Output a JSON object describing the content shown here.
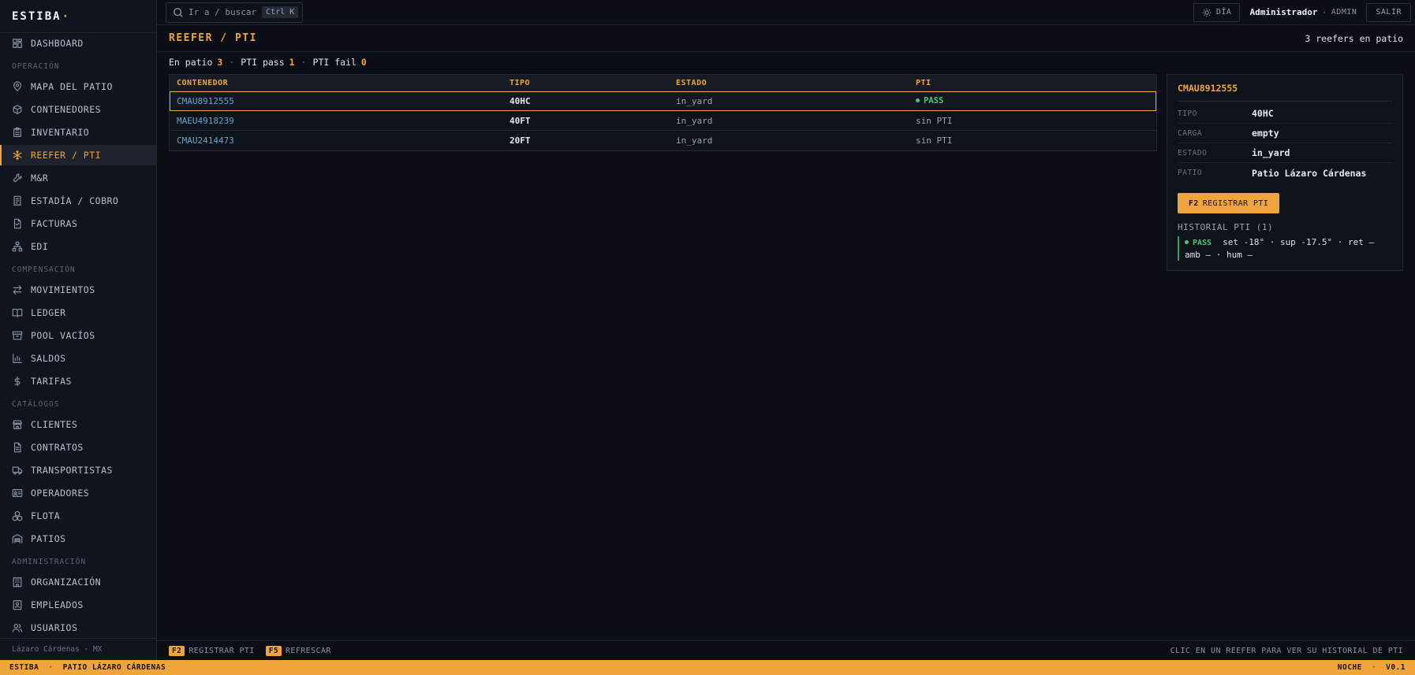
{
  "brand": {
    "name": "ESTIBA",
    "mark": "·"
  },
  "sidebar": {
    "items": [
      {
        "id": "dashboard",
        "label": "DASHBOARD",
        "icon": "dashboard-icon"
      },
      {
        "section": "OPERACIÓN"
      },
      {
        "id": "mapa",
        "label": "MAPA DEL PATIO",
        "icon": "map-pin-icon"
      },
      {
        "id": "contenedores",
        "label": "CONTENEDORES",
        "icon": "box-icon"
      },
      {
        "id": "inventario",
        "label": "INVENTARIO",
        "icon": "clipboard-icon"
      },
      {
        "id": "reefer",
        "label": "REEFER / PTI",
        "icon": "snowflake-icon",
        "active": true
      },
      {
        "id": "myr",
        "label": "M&R",
        "icon": "wrench-icon"
      },
      {
        "id": "estadia",
        "label": "ESTADÍA / COBRO",
        "icon": "receipt-icon"
      },
      {
        "id": "facturas",
        "label": "FACTURAS",
        "icon": "file-icon"
      },
      {
        "id": "edi",
        "label": "EDI",
        "icon": "network-icon"
      },
      {
        "section": "COMPENSACIÓN"
      },
      {
        "id": "movimientos",
        "label": "MOVIMIENTOS",
        "icon": "arrows-icon"
      },
      {
        "id": "ledger",
        "label": "LEDGER",
        "icon": "book-icon"
      },
      {
        "id": "pool",
        "label": "POOL VACÍOS",
        "icon": "archive-icon"
      },
      {
        "id": "saldos",
        "label": "SALDOS",
        "icon": "bar-chart-icon"
      },
      {
        "id": "tarifas",
        "label": "TARIFAS",
        "icon": "dollar-icon"
      },
      {
        "section": "CATÁLOGOS"
      },
      {
        "id": "clientes",
        "label": "CLIENTES",
        "icon": "store-icon"
      },
      {
        "id": "contratos",
        "label": "CONTRATOS",
        "icon": "document-icon"
      },
      {
        "id": "transportistas",
        "label": "TRANSPORTISTAS",
        "icon": "truck-icon"
      },
      {
        "id": "operadores",
        "label": "OPERADORES",
        "icon": "id-card-icon"
      },
      {
        "id": "flota",
        "label": "FLOTA",
        "icon": "boxes-icon"
      },
      {
        "id": "patios",
        "label": "PATIOS",
        "icon": "warehouse-icon"
      },
      {
        "section": "ADMINISTRACIÓN"
      },
      {
        "id": "organizacion",
        "label": "ORGANIZACIÓN",
        "icon": "building-icon"
      },
      {
        "id": "empleados",
        "label": "EMPLEADOS",
        "icon": "badge-icon"
      },
      {
        "id": "usuarios",
        "label": "USUARIOS",
        "icon": "users-icon"
      }
    ],
    "footer": "Lázaro Cárdenas · MX"
  },
  "topbar": {
    "search_placeholder": "Ir a / buscar",
    "search_shortcut": "Ctrl K",
    "theme_label": "DÍA",
    "user_name": "Administrador",
    "separator": "·",
    "user_role": "ADMIN",
    "logout_label": "SALIR"
  },
  "page": {
    "title": "REEFER / PTI",
    "count_label": "3 reefers en patio",
    "summary": {
      "in_yard_label": "En patio",
      "in_yard": "3",
      "pass_label": "PTI pass",
      "pass": "1",
      "fail_label": "PTI fail",
      "fail": "0",
      "sep": "·"
    }
  },
  "table": {
    "headers": {
      "container": "CONTENEDOR",
      "type": "TIPO",
      "state": "ESTADO",
      "pti": "PTI"
    },
    "rows": [
      {
        "container": "CMAU8912555",
        "type": "40HC",
        "state": "in_yard",
        "pti": "PASS",
        "pti_status": "pass",
        "selected": true
      },
      {
        "container": "MAEU4918239",
        "type": "40FT",
        "state": "in_yard",
        "pti": "sin PTI",
        "pti_status": "none"
      },
      {
        "container": "CMAU2414473",
        "type": "20FT",
        "state": "in_yard",
        "pti": "sin PTI",
        "pti_status": "none"
      }
    ]
  },
  "detail": {
    "title": "CMAU8912555",
    "fields": [
      {
        "key": "TIPO",
        "value": "40HC"
      },
      {
        "key": "CARGA",
        "value": "empty"
      },
      {
        "key": "ESTADO",
        "value": "in_yard"
      },
      {
        "key": "PATIO",
        "value": "Patio Lázaro Cárdenas"
      }
    ],
    "action_key": "F2",
    "action_label": "REGISTRAR PTI",
    "history_title": "HISTORIAL PTI (1)",
    "history": [
      {
        "status": "PASS",
        "line1": "set -18° · sup -17.5° · ret —",
        "line2": "amb — · hum —"
      }
    ]
  },
  "hints": {
    "f2_key": "F2",
    "f2_label": "REGISTRAR PTI",
    "f5_key": "F5",
    "f5_label": "REFRESCAR",
    "right_text": "CLIC EN UN REEFER PARA VER SU HISTORIAL DE PTI"
  },
  "statusbar": {
    "app": "ESTIBA",
    "sep": "·",
    "yard": "PATIO LÁZARO CÁRDENAS",
    "mode": "NOCHE",
    "version": "V0.1"
  },
  "colors": {
    "accent": "#f0a53a",
    "link": "#5fa8d8",
    "pass": "#4cc774",
    "background": "#0b0e14"
  }
}
